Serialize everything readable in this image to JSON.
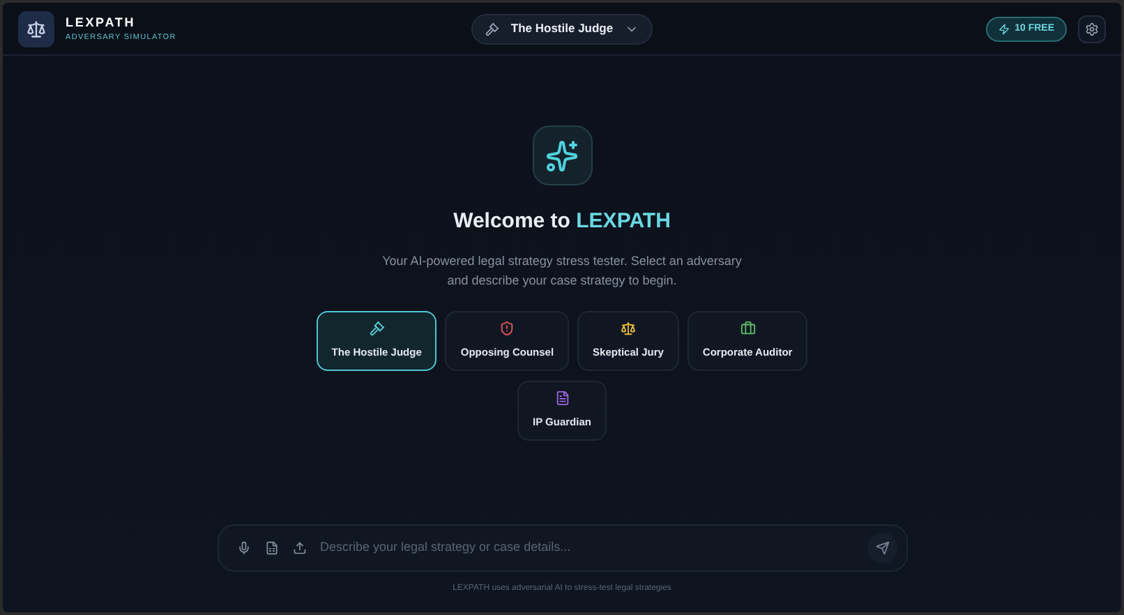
{
  "header": {
    "logo_title": "LEXPATH",
    "logo_subtitle": "ADVERSARY SIMULATOR",
    "adversary_picker": {
      "label": "The Hostile Judge"
    },
    "credits": "10 FREE"
  },
  "welcome": {
    "title_prefix": "Welcome to",
    "title_brand": "LEXPATH",
    "subtitle": "Your AI-powered legal strategy stress tester. Select an adversary and describe your case strategy to begin."
  },
  "adversaries": [
    {
      "label": "The Hostile Judge",
      "kind": "judge",
      "color": "#5fd0d8",
      "selected": true
    },
    {
      "label": "Opposing Counsel",
      "kind": "counsel",
      "color": "#e05a5a",
      "selected": false
    },
    {
      "label": "Skeptical Jury",
      "kind": "jury",
      "color": "#e8b93a",
      "selected": false
    },
    {
      "label": "Corporate Auditor",
      "kind": "auditor",
      "color": "#5fbf6a",
      "selected": false
    },
    {
      "label": "IP Guardian",
      "kind": "ip",
      "color": "#a066e0",
      "selected": false
    }
  ],
  "composer": {
    "placeholder": "Describe your legal strategy or case details..."
  },
  "footer": "LEXPATH uses adversarial AI to stress-test legal strategies"
}
